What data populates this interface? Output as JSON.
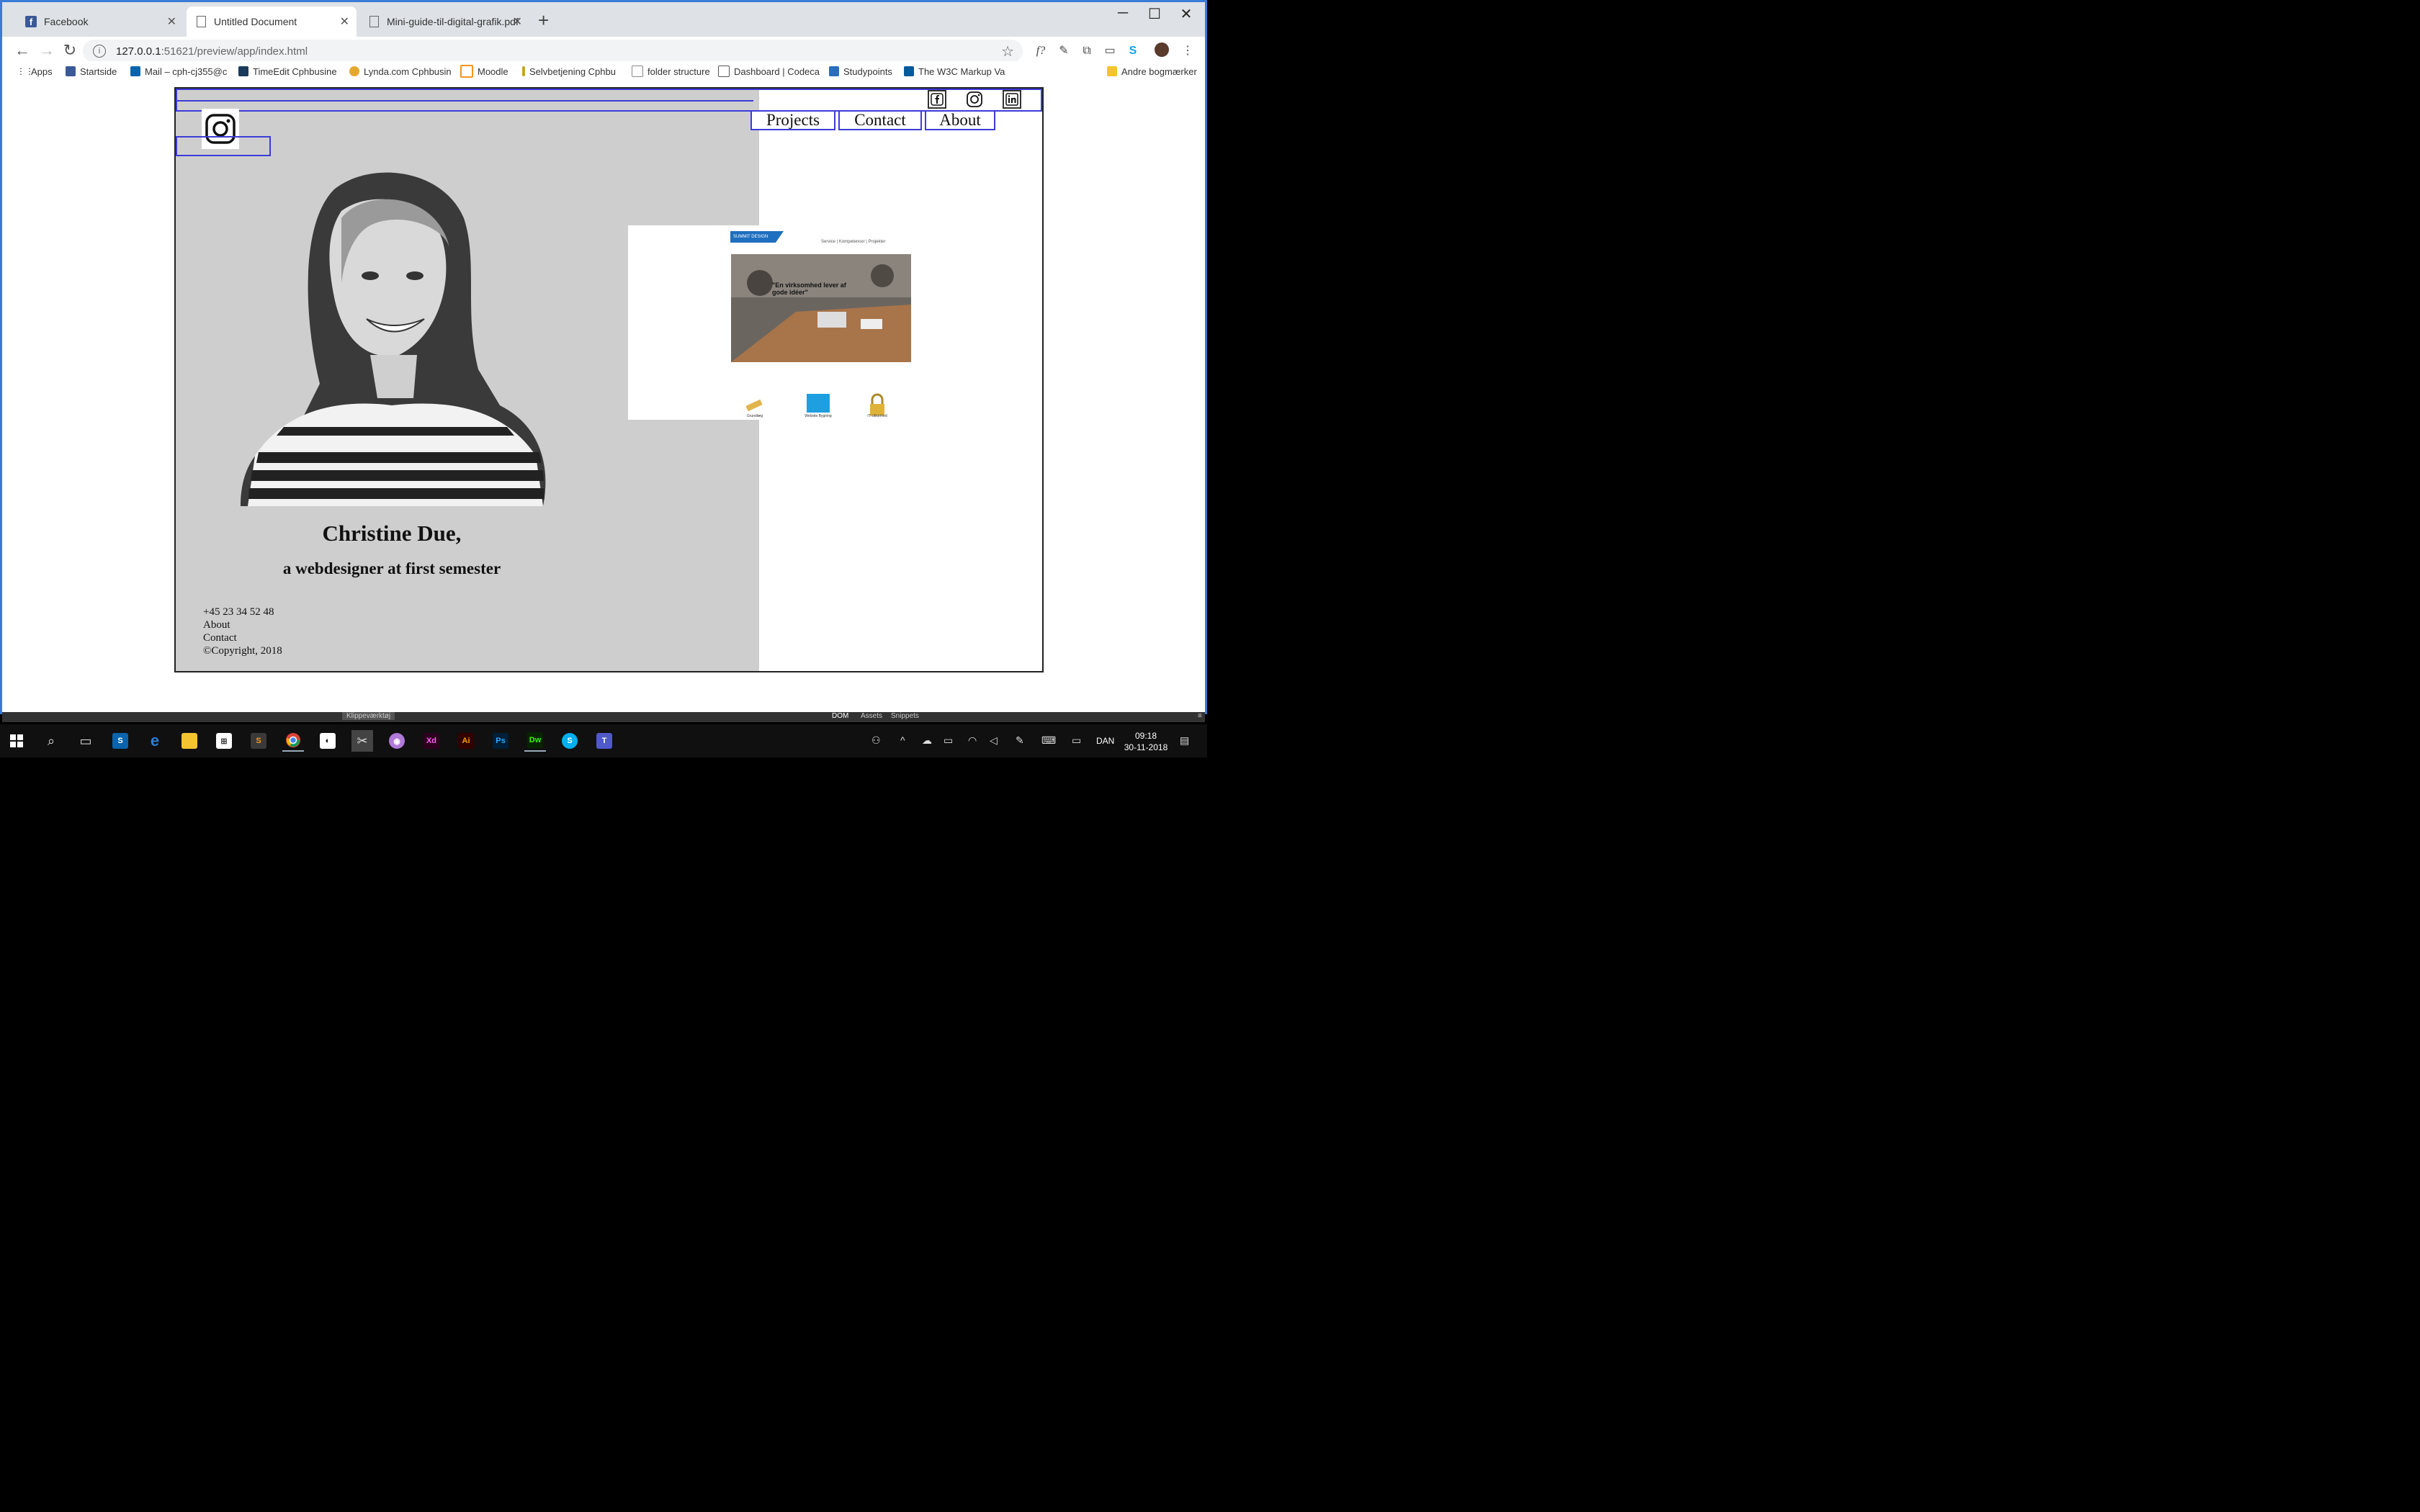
{
  "tabs": [
    {
      "label": "Facebook",
      "icon": "facebook-icon"
    },
    {
      "label": "Untitled Document",
      "icon": "document-icon"
    },
    {
      "label": "Mini-guide-til-digital-grafik.pdf",
      "icon": "document-icon"
    }
  ],
  "address": {
    "url_host": "127.0.0.1",
    "url_rest": ":51621/preview/app/index.html"
  },
  "bookmarks": [
    {
      "label": "Apps",
      "color": "#4285f4"
    },
    {
      "label": "Startside",
      "color": "#3b5998"
    },
    {
      "label": "Mail – cph-cj355@c",
      "color": "#0a64ad"
    },
    {
      "label": "TimeEdit Cphbusine",
      "color": "#1a3a5c"
    },
    {
      "label": "Lynda.com Cphbusin",
      "color": "#e5a82e"
    },
    {
      "label": "Moodle",
      "color": "#f7931e"
    },
    {
      "label": "Selvbetjening Cphbu",
      "color": "#c9a227"
    },
    {
      "label": "folder structure",
      "color": "#888888"
    },
    {
      "label": "Dashboard | Codeca",
      "color": "#555555"
    },
    {
      "label": "Studypoints",
      "color": "#2a6ebb"
    },
    {
      "label": "The W3C Markup Va",
      "color": "#005a9c"
    }
  ],
  "other_bookmarks": "Andre bogmærker",
  "site": {
    "nav": [
      "Projects",
      "Contact",
      "About"
    ],
    "social_icons": [
      "facebook-icon",
      "instagram-icon",
      "linkedin-icon"
    ],
    "name": "Christine Due,",
    "tagline": "a webdesigner at first semester",
    "footer": {
      "phone": "+45 23 34 52 48",
      "about": "About",
      "contact": "Contact",
      "copyright": "©Copyright, 2018"
    },
    "preview": {
      "logo": "SUMMIT DESIGN",
      "nav": "Service  |  Kompetencer  |  Projekter",
      "quote": "\"En virksomhed lever af gode idéer\"",
      "icons": [
        "Grundlæg",
        "Website Bygning",
        "IT-sikkerhed"
      ]
    }
  },
  "devtools": {
    "left": "Klippeværktøj",
    "tabs": [
      "DOM",
      "Assets",
      "Snippets"
    ]
  },
  "taskbar": {
    "lang": "DAN",
    "time": "09:18",
    "date": "30-11-2018"
  }
}
